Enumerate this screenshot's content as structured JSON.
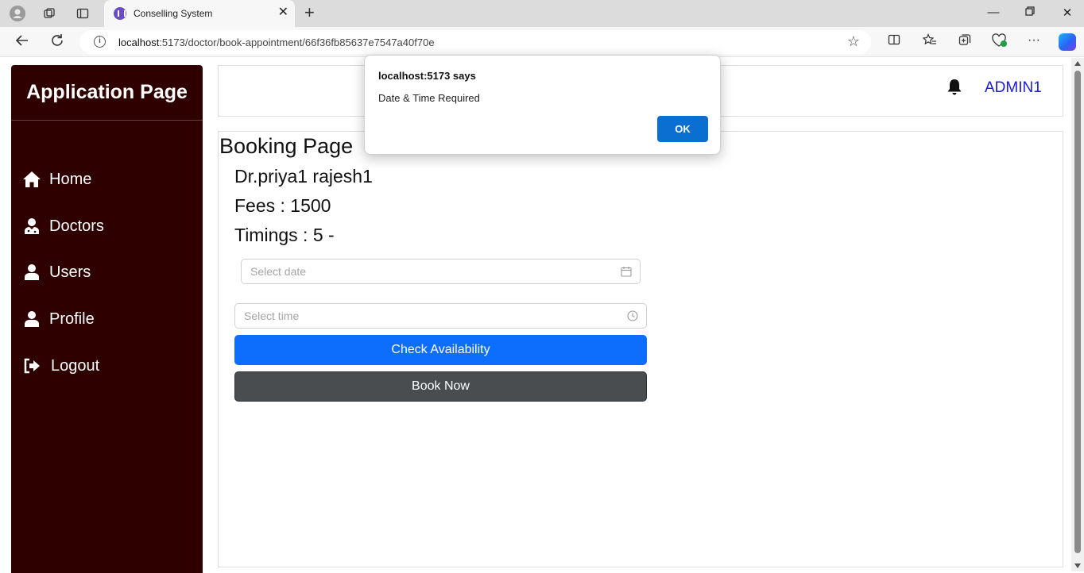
{
  "browser": {
    "tab_title": "Conselling System",
    "url_host": "localhost",
    "url_rest": ":5173/doctor/book-appointment/66f36fb85637e7547a40f70e"
  },
  "sidebar": {
    "brand": "Application Page",
    "items": [
      {
        "label": "Home",
        "icon": "home-icon"
      },
      {
        "label": "Doctors",
        "icon": "doctor-icon"
      },
      {
        "label": "Users",
        "icon": "user-icon"
      },
      {
        "label": "Profile",
        "icon": "user-icon"
      },
      {
        "label": "Logout",
        "icon": "logout-icon"
      }
    ]
  },
  "header": {
    "username": "ADMIN1"
  },
  "booking": {
    "title": "Booking Page",
    "doctor_name": "Dr.priya1 rajesh1",
    "fees": "Fees : 1500",
    "timings": "Timings : 5 -",
    "date_placeholder": "Select date",
    "time_placeholder": "Select time",
    "check_label": "Check Availability",
    "book_label": "Book Now"
  },
  "dialog": {
    "title": "localhost:5173 says",
    "message": "Date & Time Required",
    "ok_label": "OK"
  },
  "colors": {
    "sidebar_bg": "#2e0000",
    "primary": "#0d6efd",
    "dark_button": "#4a4d50",
    "username": "#1a1ad9"
  }
}
